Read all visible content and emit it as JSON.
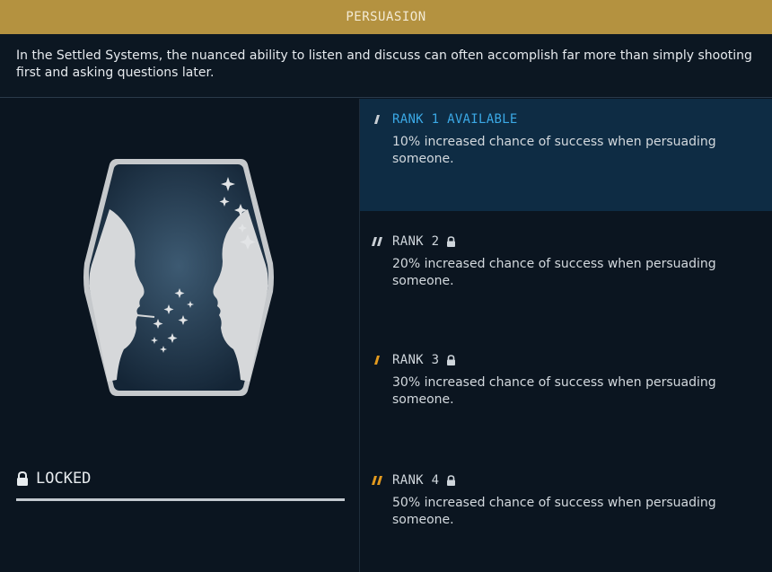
{
  "header": {
    "title": "PERSUASION"
  },
  "description": "In the Settled Systems, the nuanced ability to listen and discuss can often accomplish far more than simply shooting first and asking questions later.",
  "status": {
    "label": "LOCKED",
    "icon": "lock-icon"
  },
  "badge": {
    "icon": "persuasion-faces-icon"
  },
  "ranks": [
    {
      "title": "RANK 1 AVAILABLE",
      "description": "10% increased chance of success when persuading someone.",
      "locked": false,
      "pip_color": "#c9cfd5"
    },
    {
      "title": "RANK 2",
      "description": "20% increased chance of success when persuading someone.",
      "locked": true,
      "pip_color": "#c9cfd5"
    },
    {
      "title": "RANK 3",
      "description": "30% increased chance of success when persuading someone.",
      "locked": true,
      "pip_color": "#e39a1e"
    },
    {
      "title": "RANK 4",
      "description": "50% increased chance of success when persuading someone.",
      "locked": true,
      "pip_color": "#e39a1e"
    }
  ],
  "colors": {
    "header": "#b49240",
    "available": "#3ba9e6",
    "selected_bg": "#0e2c44",
    "gold": "#e39a1e"
  }
}
